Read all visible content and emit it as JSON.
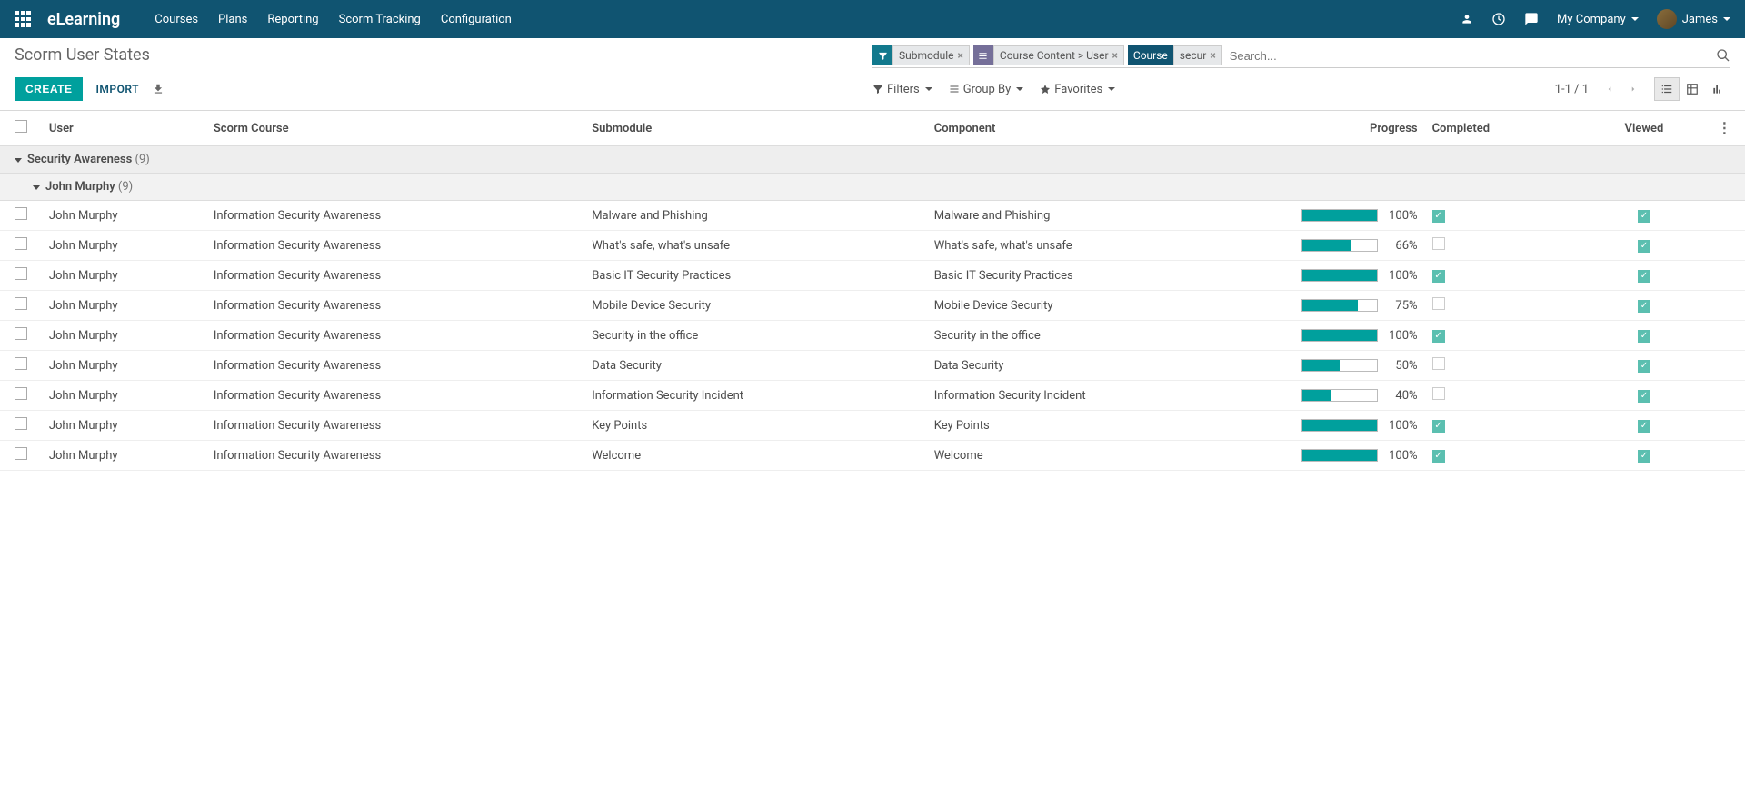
{
  "header": {
    "appTitle": "eLearning",
    "menu": [
      "Courses",
      "Plans",
      "Reporting",
      "Scorm Tracking",
      "Configuration"
    ],
    "company": "My Company",
    "user": "James"
  },
  "controlPanel": {
    "title": "Scorm User States",
    "createLabel": "CREATE",
    "importLabel": "IMPORT",
    "facets": [
      {
        "type": "filter",
        "label": "Submodule"
      },
      {
        "type": "group",
        "label": "Course Content > User"
      },
      {
        "type": "search",
        "key": "Course",
        "value": "secur"
      }
    ],
    "searchPlaceholder": "Search...",
    "filtersLabel": "Filters",
    "groupByLabel": "Group By",
    "favoritesLabel": "Favorites",
    "pageRange": "1-1 / 1"
  },
  "table": {
    "headers": {
      "user": "User",
      "course": "Scorm Course",
      "submodule": "Submodule",
      "component": "Component",
      "progress": "Progress",
      "completed": "Completed",
      "viewed": "Viewed"
    },
    "groups": [
      {
        "label": "Security Awareness",
        "count": "(9)",
        "subgroups": [
          {
            "label": "John Murphy",
            "count": "(9)",
            "rows": [
              {
                "user": "John Murphy",
                "course": "Information Security Awareness",
                "submodule": "Malware and Phishing",
                "component": "Malware and Phishing",
                "progress": 100,
                "completed": true,
                "viewed": true
              },
              {
                "user": "John Murphy",
                "course": "Information Security Awareness",
                "submodule": "What's safe, what's unsafe",
                "component": "What's safe, what's unsafe",
                "progress": 66,
                "completed": false,
                "viewed": true
              },
              {
                "user": "John Murphy",
                "course": "Information Security Awareness",
                "submodule": "Basic IT Security Practices",
                "component": "Basic IT Security Practices",
                "progress": 100,
                "completed": true,
                "viewed": true
              },
              {
                "user": "John Murphy",
                "course": "Information Security Awareness",
                "submodule": "Mobile Device Security",
                "component": "Mobile Device Security",
                "progress": 75,
                "completed": false,
                "viewed": true
              },
              {
                "user": "John Murphy",
                "course": "Information Security Awareness",
                "submodule": "Security in the office",
                "component": "Security in the office",
                "progress": 100,
                "completed": true,
                "viewed": true
              },
              {
                "user": "John Murphy",
                "course": "Information Security Awareness",
                "submodule": "Data Security",
                "component": "Data Security",
                "progress": 50,
                "completed": false,
                "viewed": true
              },
              {
                "user": "John Murphy",
                "course": "Information Security Awareness",
                "submodule": "Information Security Incident",
                "component": "Information Security Incident",
                "progress": 40,
                "completed": false,
                "viewed": true
              },
              {
                "user": "John Murphy",
                "course": "Information Security Awareness",
                "submodule": "Key Points",
                "component": "Key Points",
                "progress": 100,
                "completed": true,
                "viewed": true
              },
              {
                "user": "John Murphy",
                "course": "Information Security Awareness",
                "submodule": "Welcome",
                "component": "Welcome",
                "progress": 100,
                "completed": true,
                "viewed": true
              }
            ]
          }
        ]
      }
    ]
  }
}
